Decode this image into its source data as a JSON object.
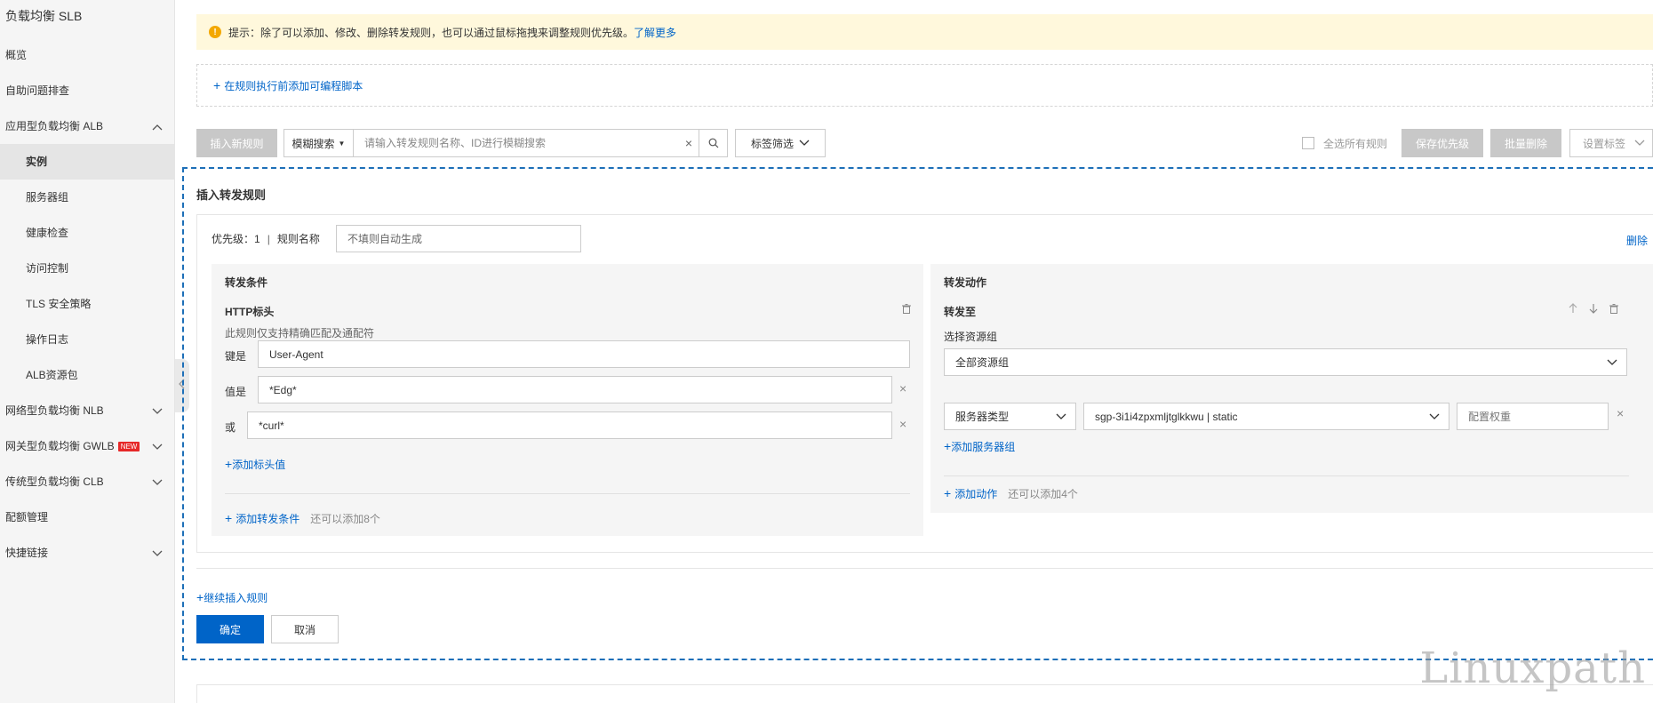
{
  "sidebar": {
    "title": "负载均衡 SLB",
    "items": [
      {
        "label": "概览"
      },
      {
        "label": "自助问题排查"
      },
      {
        "label": "应用型负载均衡 ALB"
      },
      {
        "label": "实例"
      },
      {
        "label": "服务器组"
      },
      {
        "label": "健康检查"
      },
      {
        "label": "访问控制"
      },
      {
        "label": "TLS 安全策略"
      },
      {
        "label": "操作日志"
      },
      {
        "label": "ALB资源包"
      },
      {
        "label": "网络型负载均衡 NLB"
      },
      {
        "label": "网关型负载均衡 GWLB",
        "badge": "NEW"
      },
      {
        "label": "传统型负载均衡 CLB"
      },
      {
        "label": "配额管理"
      },
      {
        "label": "快捷链接"
      }
    ]
  },
  "tip": {
    "text": "提示：除了可以添加、修改、删除转发规则，也可以通过鼠标拖拽来调整规则优先级。",
    "link": "了解更多"
  },
  "script_link": "在规则执行前添加可编程脚本",
  "toolbar": {
    "insert_rule": "插入新规则",
    "search_type": "模糊搜索",
    "search_placeholder": "请输入转发规则名称、ID进行模糊搜索",
    "tag_filter": "标签筛选",
    "select_all": "全选所有规则",
    "save_priority": "保存优先级",
    "batch_delete": "批量删除",
    "set_tag": "设置标签"
  },
  "insert_panel": {
    "title": "插入转发规则",
    "priority_label": "优先级：",
    "priority_value": "1",
    "separator": "|",
    "rule_name_label": "规则名称",
    "rule_name_placeholder": "不填则自动生成",
    "delete": "删除",
    "conditions": {
      "title": "转发条件",
      "type": "HTTP标头",
      "hint": "此规则仅支持精确匹配及通配符",
      "key_label": "键是",
      "key_value": "User-Agent",
      "value_label": "值是",
      "value_1": "*Edg*",
      "or_label": "或",
      "value_2": "*curl*",
      "add_header_value": "添加标头值",
      "add_condition": "添加转发条件",
      "remaining": "还可以添加8个"
    },
    "actions": {
      "title": "转发动作",
      "type": "转发至",
      "resource_group_label": "选择资源组",
      "resource_group_value": "全部资源组",
      "server_type": "服务器类型",
      "server_group": "sgp-3i1i4zpxmljtglkkwu | static",
      "weight_placeholder": "配置权重",
      "add_server_group": "添加服务器组",
      "add_action": "添加动作",
      "remaining": "还可以添加4个"
    },
    "continue_insert": "继续插入规则",
    "confirm": "确定",
    "cancel": "取消"
  },
  "watermark": "Linuxpath",
  "colors": {
    "primary": "#0064c8",
    "tip_bg": "#fff8dc",
    "warning": "#f3a800",
    "disabled": "#c8c8c8",
    "badge": "#e62828"
  }
}
